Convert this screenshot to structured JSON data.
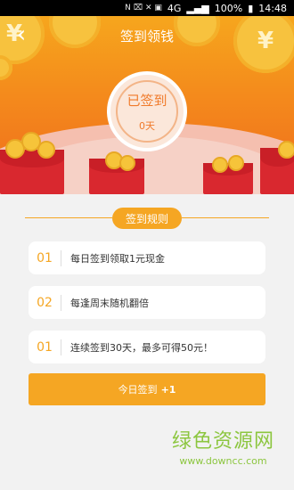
{
  "status_bar": {
    "battery": "100%",
    "time": "14:48",
    "network": "4G"
  },
  "header": {
    "title": "签到领钱"
  },
  "badge": {
    "label": "已签到",
    "days": "0天"
  },
  "rules": {
    "heading": "签到规则",
    "items": [
      {
        "num": "01",
        "text": "每日签到领取1元现金"
      },
      {
        "num": "02",
        "text": "每逢周末随机翻倍"
      },
      {
        "num": "01",
        "text": "连续签到30天，最多可得50元！"
      }
    ]
  },
  "button": {
    "label": "今日签到",
    "bonus": "+1"
  },
  "watermark": {
    "title": "绿色资源网",
    "url": "www.downcc.com"
  },
  "colors": {
    "accent": "#f5a623",
    "hero_top": "#f6a61d",
    "hero_bottom": "#ef6b1c",
    "envelope": "#d9282f"
  },
  "icons": {
    "back": "chevron-left-icon",
    "coin": "yuan-coin-icon"
  }
}
